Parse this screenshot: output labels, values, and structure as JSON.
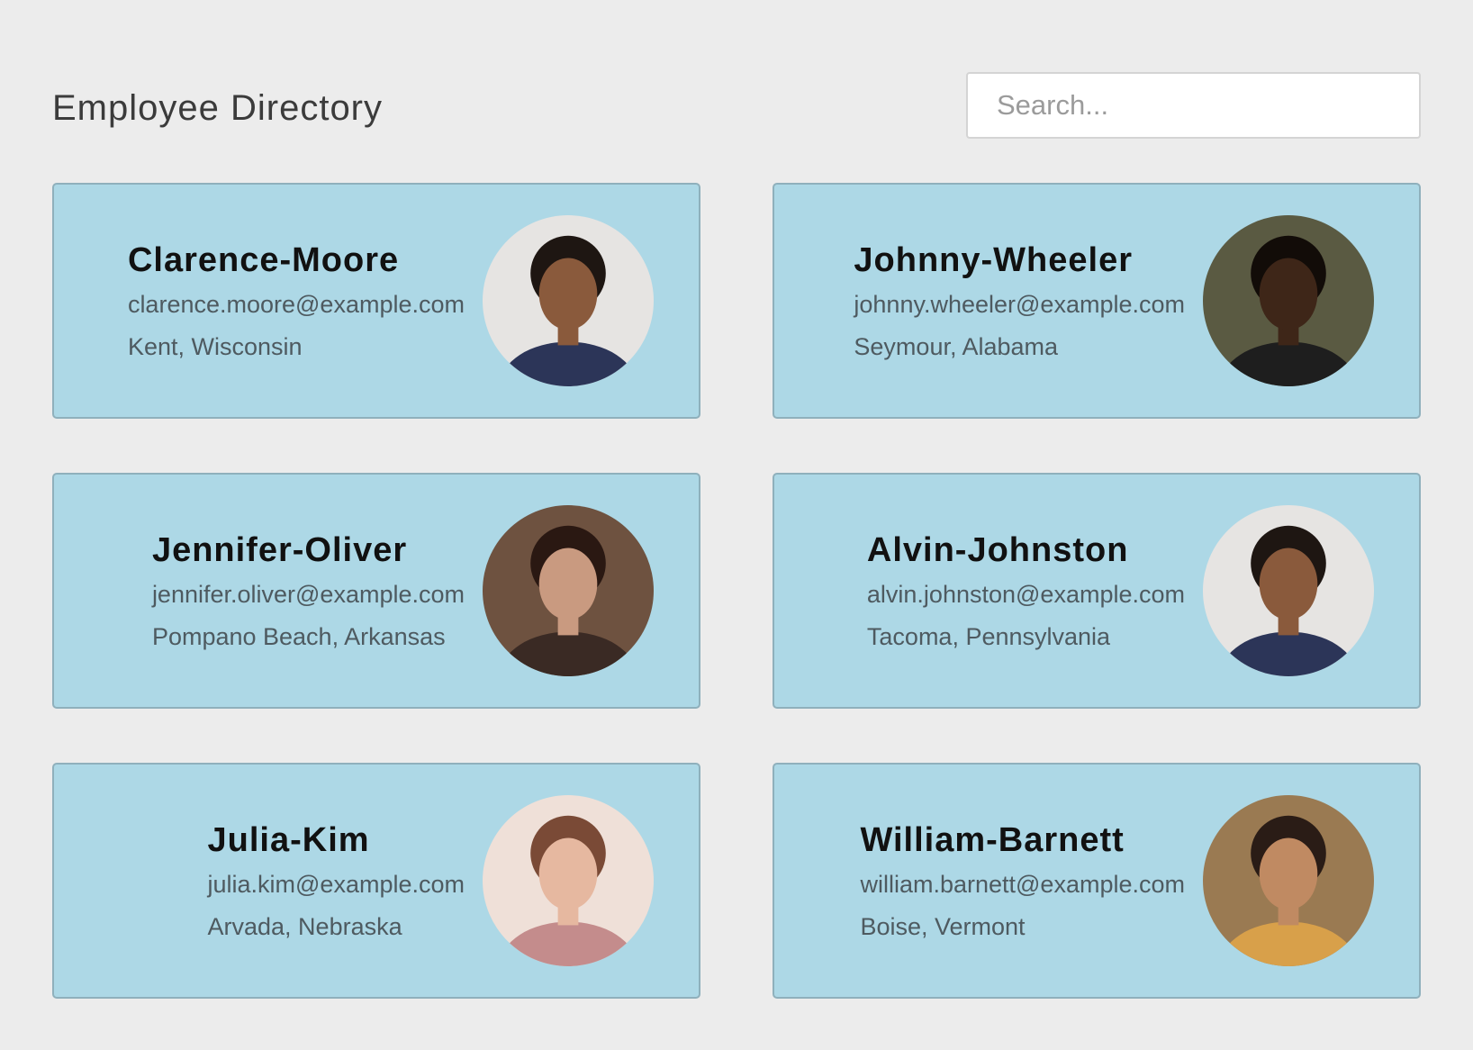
{
  "header": {
    "title": "Employee Directory",
    "search_placeholder": "Search..."
  },
  "employees": [
    {
      "name": "Clarence-Moore",
      "email": "clarence.moore@example.com",
      "location": "Kent, Wisconsin",
      "avatar": {
        "bg": "#e6e4e2",
        "skin": "#8a5a3c",
        "hair": "#1e1612",
        "shirt": "#2c3558"
      }
    },
    {
      "name": "Johnny-Wheeler",
      "email": "johnny.wheeler@example.com",
      "location": "Seymour, Alabama",
      "avatar": {
        "bg": "#5a5a42",
        "skin": "#3e2618",
        "hair": "#120c08",
        "shirt": "#1e1e1e"
      }
    },
    {
      "name": "Jennifer-Oliver",
      "email": "jennifer.oliver@example.com",
      "location": "Pompano Beach, Arkansas",
      "avatar": {
        "bg": "#6e5240",
        "skin": "#c99a80",
        "hair": "#2a1812",
        "shirt": "#3a2a24"
      }
    },
    {
      "name": "Alvin-Johnston",
      "email": "alvin.johnston@example.com",
      "location": "Tacoma, Pennsylvania",
      "avatar": {
        "bg": "#e6e4e2",
        "skin": "#8a5a3c",
        "hair": "#1e1612",
        "shirt": "#2c3558"
      }
    },
    {
      "name": "Julia-Kim",
      "email": "julia.kim@example.com",
      "location": "Arvada, Nebraska",
      "avatar": {
        "bg": "#efe0d8",
        "skin": "#e6b8a0",
        "hair": "#7a4a36",
        "shirt": "#c48c8c"
      }
    },
    {
      "name": "William-Barnett",
      "email": "william.barnett@example.com",
      "location": "Boise, Vermont",
      "avatar": {
        "bg": "#9a7a52",
        "skin": "#c08a62",
        "hair": "#2a1c16",
        "shirt": "#d8a04a"
      }
    }
  ]
}
